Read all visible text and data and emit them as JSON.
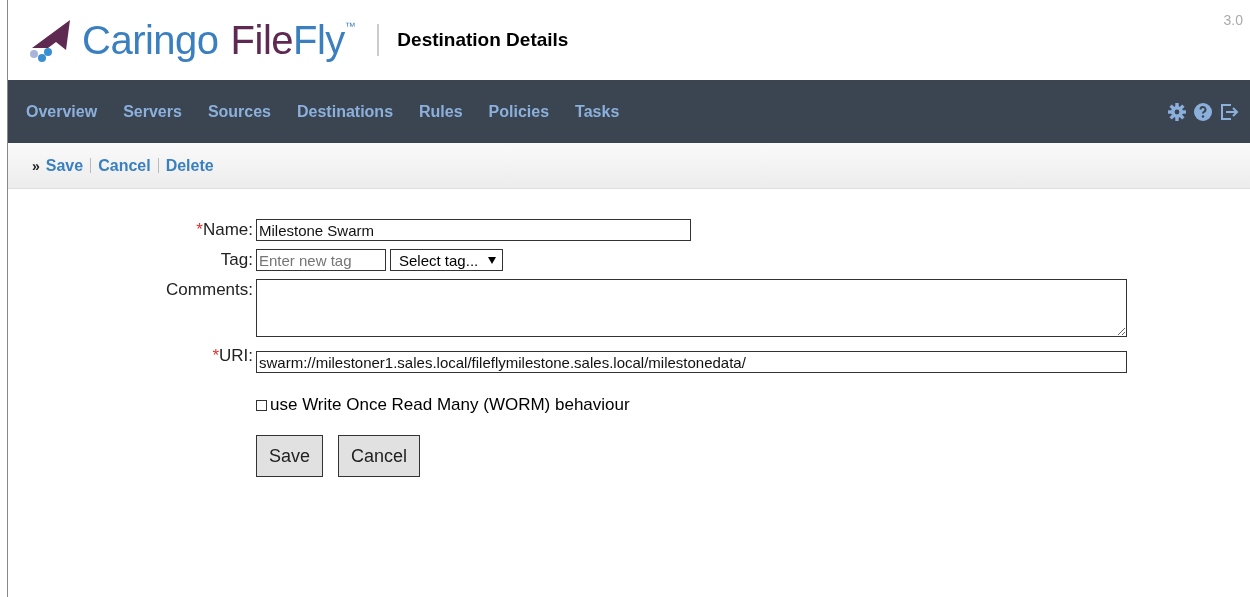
{
  "logo": {
    "brand": "Caringo",
    "product_a": "File",
    "product_b": "Fly",
    "mark": "™"
  },
  "page_title": "Destination Details",
  "version": "3.0",
  "nav": [
    {
      "label": "Overview"
    },
    {
      "label": "Servers"
    },
    {
      "label": "Sources"
    },
    {
      "label": "Destinations"
    },
    {
      "label": "Rules"
    },
    {
      "label": "Policies"
    },
    {
      "label": "Tasks"
    }
  ],
  "actions": {
    "marker": "»",
    "links": [
      "Save",
      "Cancel",
      "Delete"
    ]
  },
  "form": {
    "fields": [
      {
        "kind": "text",
        "label": "Name:",
        "required": true,
        "value": "Milestone Swarm"
      },
      {
        "kind": "tag",
        "label": "Tag:",
        "required": false,
        "placeholder": "Enter new tag",
        "select": "Select tag..."
      },
      {
        "kind": "textarea",
        "label": "Comments:",
        "required": false
      },
      {
        "kind": "text",
        "label": "URI:",
        "required": true,
        "value": "swarm://milestoner1.sales.local/fileflymilestone.sales.local/milestonedata/"
      }
    ],
    "required_mark": "*",
    "worm": {
      "label": "use Write Once Read Many (WORM) behaviour",
      "checked": false
    },
    "buttons": [
      "Save",
      "Cancel"
    ]
  }
}
